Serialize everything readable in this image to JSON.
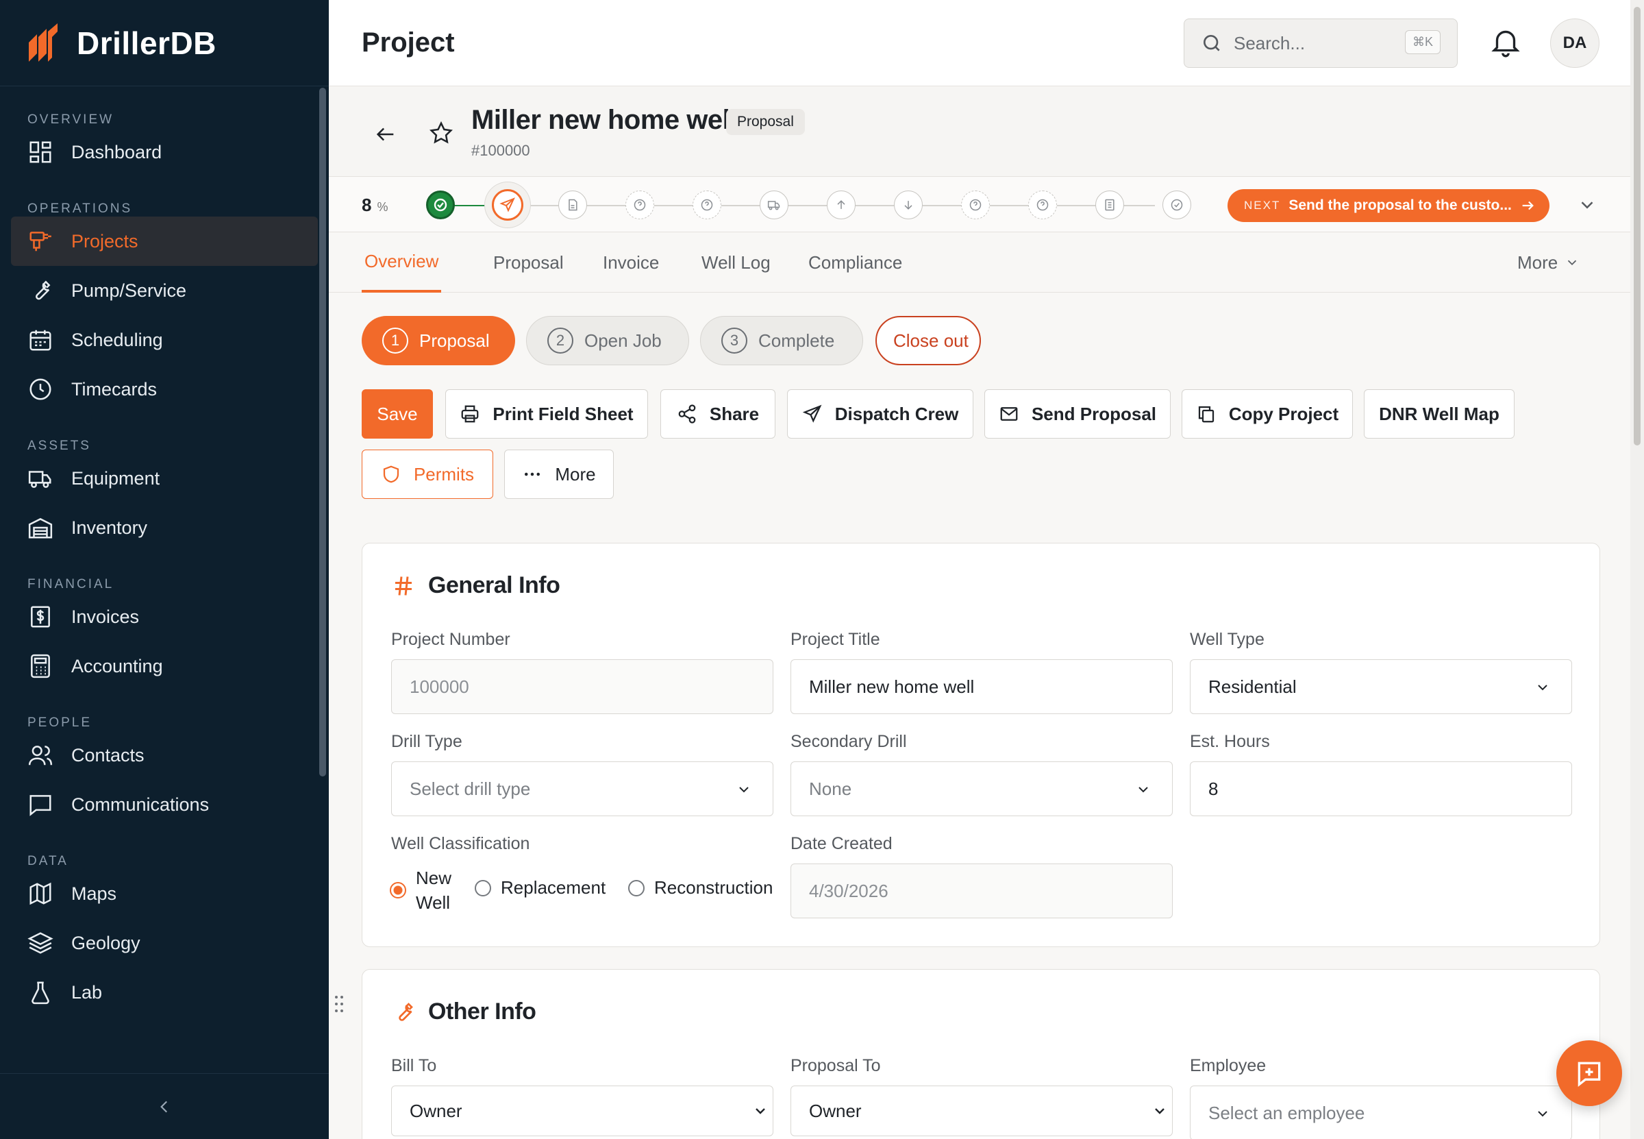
{
  "app": {
    "name": "DrillerDB",
    "accent": "#f26a2a",
    "sidebar_bg": "#0d1f2d"
  },
  "sidebar": {
    "sections": [
      {
        "title": "OVERVIEW",
        "items": [
          {
            "label": "Dashboard",
            "icon": "grid-icon"
          }
        ]
      },
      {
        "title": "OPERATIONS",
        "items": [
          {
            "label": "Projects",
            "icon": "drill-icon",
            "active": true
          },
          {
            "label": "Pump/Service",
            "icon": "wrench-icon"
          },
          {
            "label": "Scheduling",
            "icon": "calendar-icon"
          },
          {
            "label": "Timecards",
            "icon": "clock-icon"
          }
        ]
      },
      {
        "title": "ASSETS",
        "items": [
          {
            "label": "Equipment",
            "icon": "truck-icon"
          },
          {
            "label": "Inventory",
            "icon": "warehouse-icon"
          }
        ]
      },
      {
        "title": "FINANCIAL",
        "items": [
          {
            "label": "Invoices",
            "icon": "invoice-icon"
          },
          {
            "label": "Accounting",
            "icon": "calculator-icon"
          }
        ]
      },
      {
        "title": "PEOPLE",
        "items": [
          {
            "label": "Contacts",
            "icon": "users-icon"
          },
          {
            "label": "Communications",
            "icon": "message-icon"
          }
        ]
      },
      {
        "title": "DATA",
        "items": [
          {
            "label": "Maps",
            "icon": "map-icon"
          },
          {
            "label": "Geology",
            "icon": "layers-icon"
          },
          {
            "label": "Lab",
            "icon": "flask-icon"
          }
        ]
      }
    ]
  },
  "topbar": {
    "title": "Project",
    "search_placeholder": "Search...",
    "search_shortcut": "⌘K",
    "avatar_initials": "DA"
  },
  "project": {
    "name": "Miller new home well",
    "stage_badge": "Proposal",
    "number_label": "#100000"
  },
  "progress": {
    "percent": "8",
    "percent_symbol": "%",
    "steps": [
      "complete",
      "current",
      "document",
      "question",
      "question",
      "truck",
      "upload",
      "download",
      "question",
      "question",
      "receipt",
      "check"
    ],
    "next_label": "NEXT",
    "next_text": "Send the proposal to the custo..."
  },
  "tabs": [
    {
      "label": "Overview",
      "active": true
    },
    {
      "label": "Proposal"
    },
    {
      "label": "Invoice"
    },
    {
      "label": "Well Log"
    },
    {
      "label": "Compliance"
    }
  ],
  "tabs_more": "More",
  "stages": [
    {
      "num": "1",
      "label": "Proposal",
      "active": true
    },
    {
      "num": "2",
      "label": "Open Job"
    },
    {
      "num": "3",
      "label": "Complete"
    }
  ],
  "close_out": "Close out",
  "actions": {
    "save": "Save",
    "print": "Print Field Sheet",
    "share": "Share",
    "dispatch": "Dispatch Crew",
    "send": "Send Proposal",
    "copy": "Copy Project",
    "dnr": "DNR Well Map",
    "permits": "Permits",
    "more": "More"
  },
  "general_info": {
    "title": "General Info",
    "project_number_label": "Project Number",
    "project_number_value": "100000",
    "project_title_label": "Project Title",
    "project_title_value": "Miller new home well",
    "well_type_label": "Well Type",
    "well_type_value": "Residential",
    "drill_type_label": "Drill Type",
    "drill_type_placeholder": "Select drill type",
    "secondary_drill_label": "Secondary Drill",
    "secondary_drill_value": "None",
    "est_hours_label": "Est. Hours",
    "est_hours_value": "8",
    "well_class_label": "Well Classification",
    "well_class_options": [
      "New Well",
      "Replacement",
      "Reconstruction"
    ],
    "well_class_selected": "New Well",
    "date_created_label": "Date Created",
    "date_created_value": "4/30/2026"
  },
  "other_info": {
    "title": "Other Info",
    "bill_to_label": "Bill To",
    "bill_to_value": "Owner",
    "proposal_to_label": "Proposal To",
    "proposal_to_value": "Owner",
    "employee_label": "Employee",
    "employee_placeholder": "Select an employee"
  }
}
